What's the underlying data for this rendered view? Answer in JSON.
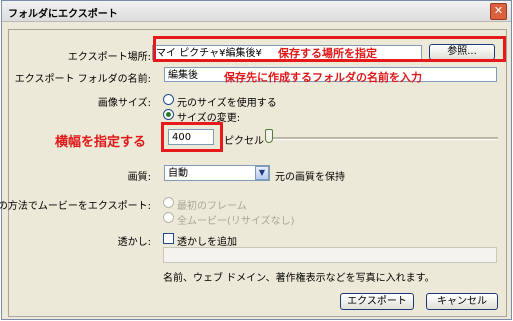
{
  "window": {
    "title": "フォルダにエクスポート"
  },
  "location": {
    "label": "エクスポート場所:",
    "value": "マイ ピクチャ¥編集後¥",
    "browse_label": "参照...",
    "annotation": "保存する場所を指定"
  },
  "folder_name": {
    "label": "エクスポート フォルダの名前:",
    "value": "編集後",
    "annotation": "保存先に作成するフォルダの名前を入力"
  },
  "image_size": {
    "label": "画像サイズ:",
    "option_original": "元のサイズを使用する",
    "option_change": "サイズの変更:",
    "width_value": "400",
    "unit": "ピクセル",
    "annotation": "横幅を指定する"
  },
  "quality": {
    "label": "画質:",
    "selected": "自動",
    "note": "元の画質を保持"
  },
  "movie": {
    "label": "次の方法でムービーをエクスポート:",
    "option_first_frame": "最初のフレーム",
    "option_all": "全ムービー(リサイズなし)"
  },
  "watermark": {
    "label": "透かし:",
    "checkbox_label": "透かしを追加",
    "text_value": "",
    "hint": "名前、ウェブ ドメイン、著作権表示などを写真に入れます。"
  },
  "buttons": {
    "export_label": "エクスポート",
    "cancel_label": "キャンセル"
  },
  "colors": {
    "annotation": "#e01818",
    "window_bg": "#ece9d8"
  }
}
